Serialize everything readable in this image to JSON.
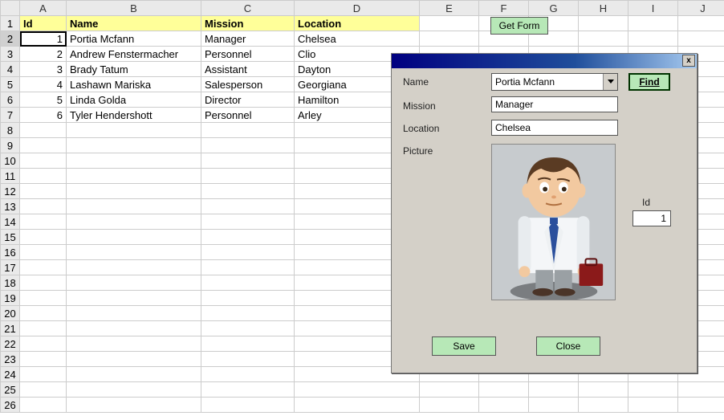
{
  "columns": [
    "A",
    "B",
    "C",
    "D",
    "E",
    "F",
    "G",
    "H",
    "I",
    "J"
  ],
  "row_count": 26,
  "header": {
    "id": "Id",
    "name": "Name",
    "mission": "Mission",
    "location": "Location"
  },
  "rows": [
    {
      "id": "1",
      "name": "Portia Mcfann",
      "mission": "Manager",
      "location": "Chelsea"
    },
    {
      "id": "2",
      "name": "Andrew Fenstermacher",
      "mission": "Personnel",
      "location": "Clio"
    },
    {
      "id": "3",
      "name": "Brady Tatum",
      "mission": "Assistant",
      "location": "Dayton"
    },
    {
      "id": "4",
      "name": "Lashawn Mariska",
      "mission": "Salesperson",
      "location": "Georgiana"
    },
    {
      "id": "5",
      "name": "Linda Golda",
      "mission": "Director",
      "location": "Hamilton"
    },
    {
      "id": "6",
      "name": "Tyler Hendershott",
      "mission": "Personnel",
      "location": "Arley"
    }
  ],
  "getform_label": "Get Form",
  "dialog": {
    "labels": {
      "name": "Name",
      "mission": "Mission",
      "location": "Location",
      "picture": "Picture",
      "id": "Id"
    },
    "name_value": "Portia Mcfann",
    "mission_value": "Manager",
    "location_value": "Chelsea",
    "id_value": "1",
    "find_label": "Find",
    "save_label": "Save",
    "close_label": "Close",
    "close_x": "x"
  },
  "selected_cell": {
    "row": 2,
    "col": "A"
  },
  "colors": {
    "header_bg": "#ffff99",
    "button_bg": "#b7e8b7",
    "dialog_bg": "#d4d0c8"
  }
}
